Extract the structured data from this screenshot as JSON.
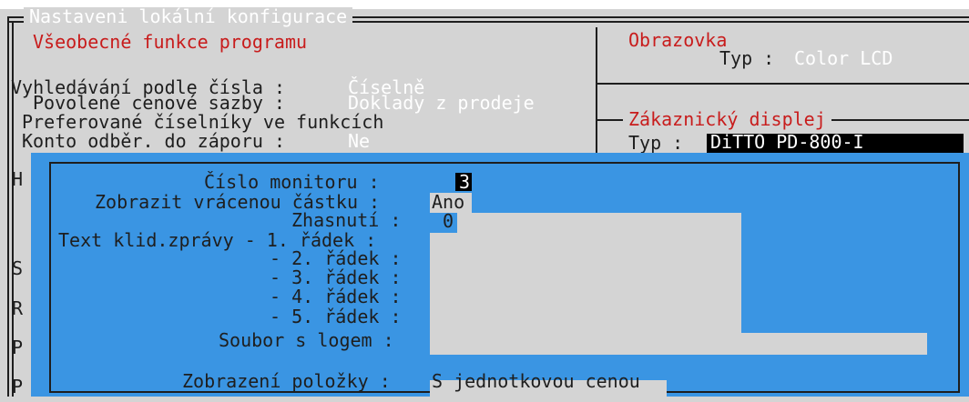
{
  "window": {
    "title": "Nastaveni lokální konfigurace"
  },
  "general": {
    "heading": "Všeobecné funkce programu",
    "search_label": "Vyhledávání podle čísla :",
    "search_value": "Číselně",
    "price_label": "Povolené cenové sazby :",
    "price_value": "Doklady z prodeje",
    "pref_label": "Preferované číselníky ve funkcích",
    "account_label": "Konto odběr. do záporu :",
    "account_value": "Ne"
  },
  "screen": {
    "heading": "Obrazovka",
    "type_label": "Typ :",
    "type_value": "Color LCD"
  },
  "customer_display": {
    "heading": "Zákaznický displej",
    "type_label": "Typ :",
    "type_value": "DiTTO PD-800-I"
  },
  "background_letters": [
    "H",
    "S",
    "R",
    "P",
    "P"
  ],
  "dialog": {
    "monitor_label": "Číslo monitoru :",
    "monitor_value": "3",
    "change_label": "Zobrazit vrácenou částku :",
    "change_value": "Ano",
    "blank_label": "Zhasnutí :",
    "blank_value": "0",
    "idle_line1_label": "Text klid.zprávy - 1. řádek :",
    "idle_line2_label": "- 2. řádek :",
    "idle_line3_label": "- 3. řádek :",
    "idle_line4_label": "- 4. řádek :",
    "idle_line5_label": "- 5. řádek :",
    "logo_label": "Soubor s logem :",
    "item_label": "Zobrazení položky :",
    "item_value": "S jednotkovou cenou"
  }
}
